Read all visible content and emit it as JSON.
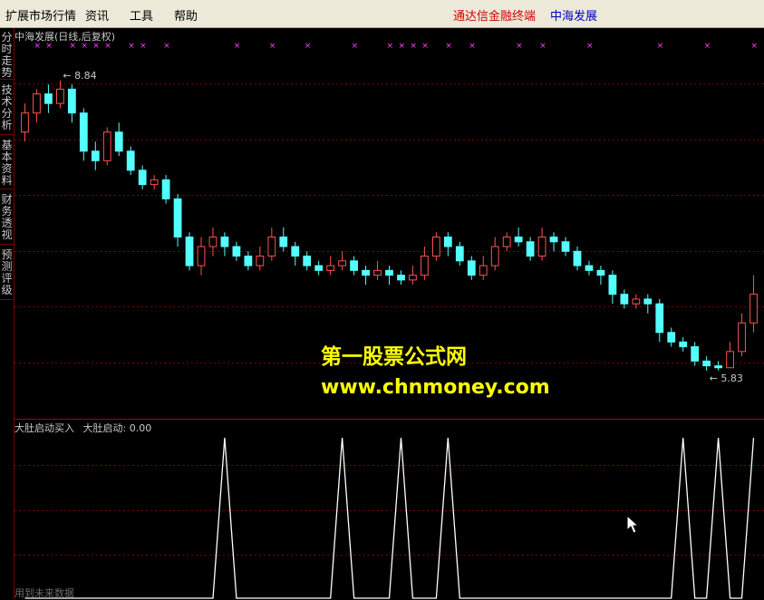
{
  "menubar": {
    "items": [
      "扩展市场行情",
      "资讯",
      "工具",
      "帮助"
    ],
    "broker": "通达信金融终端",
    "stock": "中海发展"
  },
  "sidebar": {
    "tabs": [
      "分时走势",
      "技术分析",
      "基本资料",
      "财务透视",
      "预测评级"
    ]
  },
  "price_panel": {
    "title": "中海发展(日线,后复权)",
    "high_label": "8.84",
    "low_label": "5.83",
    "marker_glyph": "×",
    "watermark_line1": "第一股票公式网",
    "watermark_line2": "www.chnmoney.com"
  },
  "indicator_panel": {
    "title": "大肚启动买入",
    "value_label": "大肚启动: 0.00",
    "bottom_note": "用到未来数据"
  },
  "colors": {
    "up": "#ff5050",
    "down": "#54ffff",
    "marker": "#ff40ff",
    "grid": "#7a0000",
    "signal": "#ffffff"
  },
  "chart_data": [
    {
      "type": "candlestick",
      "title": "中海发展(日线,后复权)",
      "ylim": [
        5.4,
        9.2
      ],
      "annotations": [
        "8.84",
        "5.83"
      ],
      "ohlc": [
        [
          8.3,
          8.5,
          8.6,
          8.2
        ],
        [
          8.5,
          8.7,
          8.75,
          8.4
        ],
        [
          8.7,
          8.6,
          8.8,
          8.5
        ],
        [
          8.6,
          8.75,
          8.84,
          8.55
        ],
        [
          8.75,
          8.5,
          8.8,
          8.4
        ],
        [
          8.5,
          8.1,
          8.55,
          8.0
        ],
        [
          8.1,
          8.0,
          8.2,
          7.9
        ],
        [
          8.0,
          8.3,
          8.35,
          7.95
        ],
        [
          8.3,
          8.1,
          8.4,
          8.05
        ],
        [
          8.1,
          7.9,
          8.15,
          7.85
        ],
        [
          7.9,
          7.75,
          7.95,
          7.7
        ],
        [
          7.75,
          7.8,
          7.85,
          7.7
        ],
        [
          7.8,
          7.6,
          7.85,
          7.55
        ],
        [
          7.6,
          7.2,
          7.65,
          7.1
        ],
        [
          7.2,
          6.9,
          7.25,
          6.85
        ],
        [
          6.9,
          7.1,
          7.2,
          6.8
        ],
        [
          7.1,
          7.2,
          7.3,
          7.0
        ],
        [
          7.2,
          7.1,
          7.25,
          7.0
        ],
        [
          7.1,
          7.0,
          7.15,
          6.95
        ],
        [
          7.0,
          6.9,
          7.05,
          6.85
        ],
        [
          6.9,
          7.0,
          7.1,
          6.85
        ],
        [
          7.0,
          7.2,
          7.3,
          6.95
        ],
        [
          7.2,
          7.1,
          7.3,
          7.05
        ],
        [
          7.1,
          7.0,
          7.15,
          6.9
        ],
        [
          7.0,
          6.9,
          7.05,
          6.85
        ],
        [
          6.9,
          6.85,
          6.95,
          6.8
        ],
        [
          6.85,
          6.9,
          7.0,
          6.8
        ],
        [
          6.9,
          6.95,
          7.05,
          6.85
        ],
        [
          6.95,
          6.85,
          7.0,
          6.8
        ],
        [
          6.85,
          6.8,
          6.9,
          6.7
        ],
        [
          6.8,
          6.85,
          6.95,
          6.75
        ],
        [
          6.85,
          6.8,
          6.9,
          6.7
        ],
        [
          6.8,
          6.75,
          6.85,
          6.7
        ],
        [
          6.75,
          6.8,
          6.9,
          6.7
        ],
        [
          6.8,
          7.0,
          7.1,
          6.75
        ],
        [
          7.0,
          7.2,
          7.25,
          6.95
        ],
        [
          7.2,
          7.1,
          7.25,
          7.0
        ],
        [
          7.1,
          6.95,
          7.15,
          6.9
        ],
        [
          6.95,
          6.8,
          7.0,
          6.75
        ],
        [
          6.8,
          6.9,
          7.0,
          6.75
        ],
        [
          6.9,
          7.1,
          7.2,
          6.85
        ],
        [
          7.1,
          7.2,
          7.25,
          7.05
        ],
        [
          7.2,
          7.15,
          7.3,
          7.1
        ],
        [
          7.15,
          7.0,
          7.2,
          6.95
        ],
        [
          7.0,
          7.2,
          7.3,
          6.95
        ],
        [
          7.2,
          7.15,
          7.25,
          7.05
        ],
        [
          7.15,
          7.05,
          7.2,
          7.0
        ],
        [
          7.05,
          6.9,
          7.1,
          6.85
        ],
        [
          6.9,
          6.85,
          6.95,
          6.8
        ],
        [
          6.85,
          6.8,
          6.9,
          6.7
        ],
        [
          6.8,
          6.6,
          6.85,
          6.5
        ],
        [
          6.6,
          6.5,
          6.65,
          6.45
        ],
        [
          6.5,
          6.55,
          6.6,
          6.45
        ],
        [
          6.55,
          6.5,
          6.6,
          6.4
        ],
        [
          6.5,
          6.2,
          6.55,
          6.1
        ],
        [
          6.2,
          6.1,
          6.25,
          6.05
        ],
        [
          6.1,
          6.05,
          6.15,
          6.0
        ],
        [
          6.05,
          5.9,
          6.1,
          5.85
        ],
        [
          5.9,
          5.85,
          5.95,
          5.8
        ],
        [
          5.85,
          5.83,
          5.9,
          5.8
        ],
        [
          5.83,
          6.0,
          6.1,
          5.83
        ],
        [
          6.0,
          6.3,
          6.4,
          5.95
        ],
        [
          6.3,
          6.6,
          6.8,
          6.2
        ]
      ]
    },
    {
      "type": "line",
      "title": "大肚启动买入",
      "signal_indices": [
        17,
        27,
        32,
        36,
        56,
        59,
        62
      ],
      "current_value": 0.0
    }
  ]
}
